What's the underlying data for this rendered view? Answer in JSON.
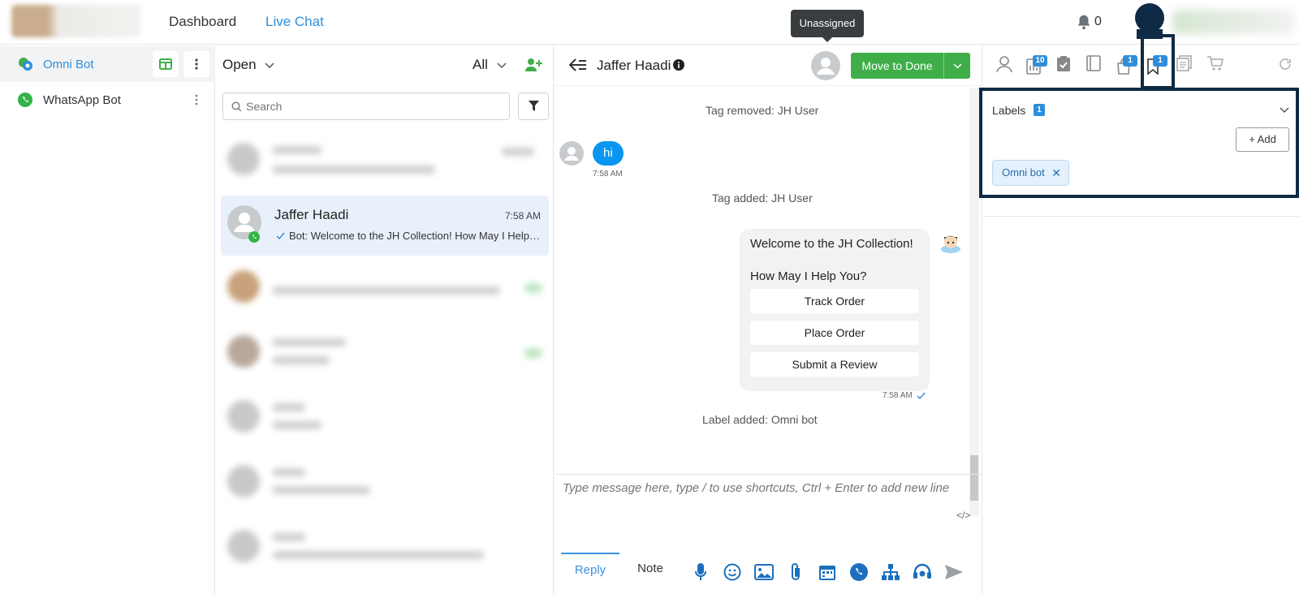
{
  "top_nav": {
    "dashboard_label": "Dashboard",
    "live_chat_label": "Live Chat",
    "notification_count": "0"
  },
  "bots": [
    {
      "label": "Omni Bot",
      "icon": "omni-bot-icon",
      "active": true
    },
    {
      "label": "WhatsApp Bot",
      "icon": "whatsapp-icon",
      "active": false
    }
  ],
  "conversations": {
    "status_filter": "Open",
    "scope_filter": "All",
    "search_placeholder": "Search",
    "active": {
      "name": "Jaffer Haadi",
      "time": "7:58 AM",
      "preview": "Bot: Welcome to the JH Collection! How May I Help You?"
    }
  },
  "chat": {
    "contact_name": "Jaffer Haadi",
    "assignee_tooltip": "Unassigned",
    "done_label": "Move to Done",
    "messages": {
      "tag_removed": "Tag removed: JH User",
      "user_msg": "hi",
      "user_time": "7:58 AM",
      "tag_added": "Tag added: JH User",
      "bot_line1": "Welcome to the JH Collection!",
      "bot_line2": "How May I Help You?",
      "bot_buttons": [
        "Track Order",
        "Place Order",
        "Submit a Review"
      ],
      "bot_time": "7:58 AM",
      "label_added": "Label added: Omni bot"
    },
    "composer_placeholder": "Type message here, type / to use shortcuts, Ctrl + Enter to add new line",
    "code_toggle": "</>",
    "reply_tab": "Reply",
    "note_tab": "Note"
  },
  "right_panel": {
    "tabs": [
      {
        "icon": "user-icon",
        "badge": ""
      },
      {
        "icon": "chart-icon",
        "badge": "10"
      },
      {
        "icon": "clipboard-icon",
        "badge": ""
      },
      {
        "icon": "notebook-icon",
        "badge": ""
      },
      {
        "icon": "bag-icon",
        "badge": "1"
      },
      {
        "icon": "bookmark-icon",
        "badge": "1"
      },
      {
        "icon": "documents-icon",
        "badge": ""
      },
      {
        "icon": "cart-icon",
        "badge": ""
      }
    ],
    "labels": {
      "title": "Labels",
      "count": "1",
      "add_label": "+ Add",
      "chips": [
        "Omni bot"
      ]
    }
  },
  "colors": {
    "accent_blue": "#0a96f0",
    "link_blue": "#3a93e0",
    "done_green": "#3fae49",
    "badge_blue": "#2f8edb",
    "highlight_navy": "#0e2a44"
  }
}
